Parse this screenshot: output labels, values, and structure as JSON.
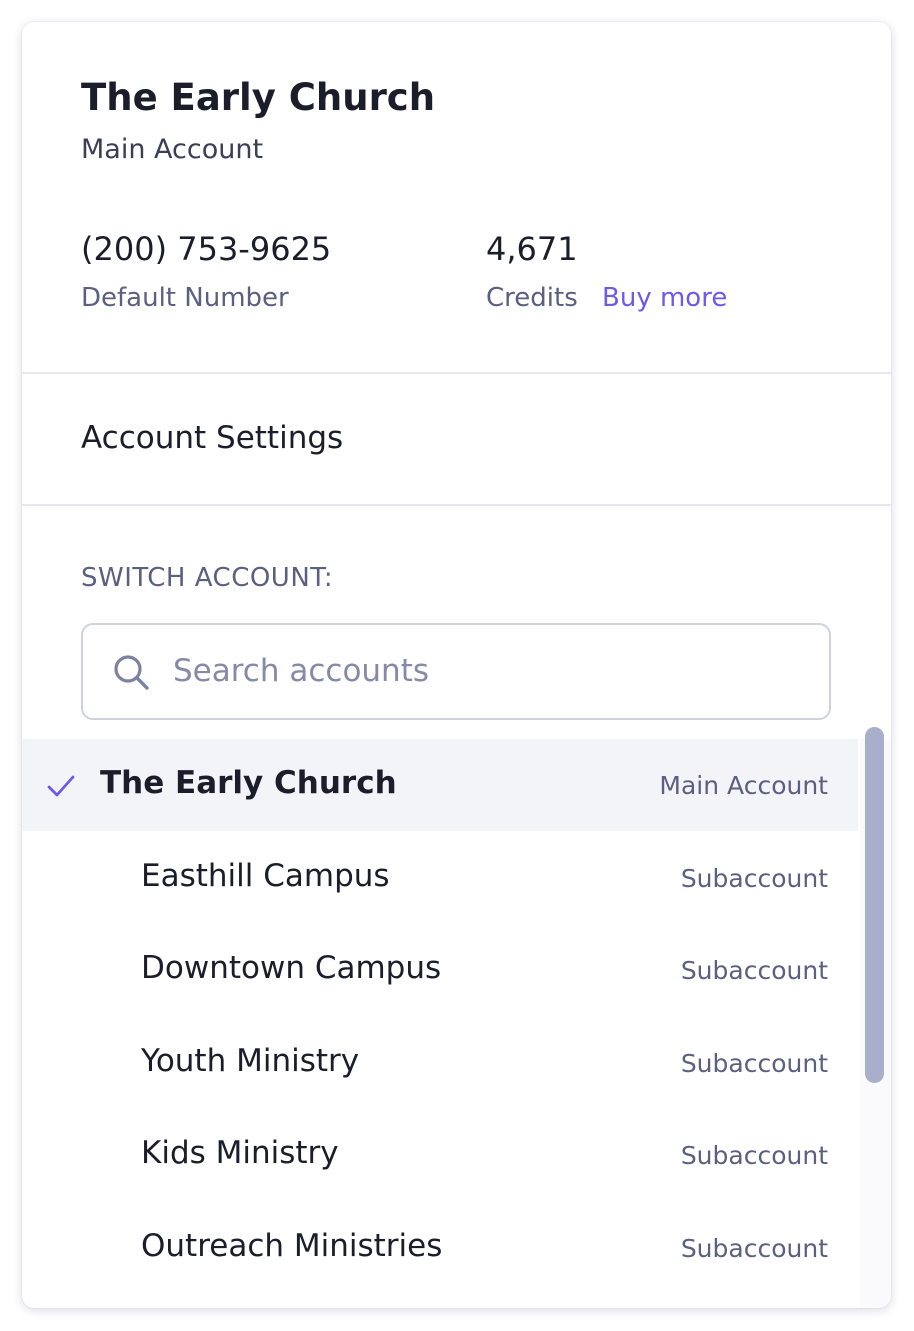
{
  "account": {
    "name": "The Early Church",
    "type": "Main Account",
    "phone": "(200) 753-9625",
    "phone_label": "Default Number",
    "credits": "4,671",
    "credits_label": "Credits",
    "buy_more": "Buy more"
  },
  "menu": {
    "settings_label": "Account Settings"
  },
  "switcher": {
    "heading": "SWITCH ACCOUNT:",
    "search_placeholder": "Search accounts",
    "search_value": "",
    "accounts": [
      {
        "name": "The Early Church",
        "type": "Main Account",
        "selected": true
      },
      {
        "name": "Easthill Campus",
        "type": "Subaccount"
      },
      {
        "name": "Downtown Campus",
        "type": "Subaccount"
      },
      {
        "name": "Youth Ministry",
        "type": "Subaccount"
      },
      {
        "name": "Kids Ministry",
        "type": "Subaccount"
      },
      {
        "name": "Outreach Ministries",
        "type": "Subaccount"
      }
    ]
  },
  "colors": {
    "accent": "#7058e8",
    "selected_row_bg": "#f3f4f8",
    "scrollbar_thumb": "#a9aecb"
  },
  "icons": {
    "search": "search-icon",
    "selected": "checkmark-icon"
  }
}
